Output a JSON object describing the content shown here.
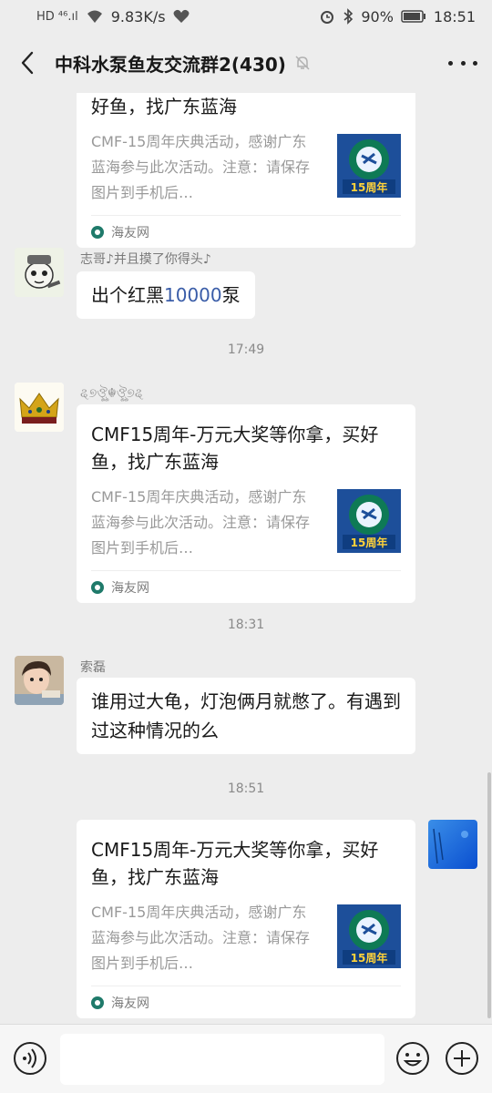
{
  "status_bar": {
    "left_icons": "HD ⁴⁶.ıl",
    "speed": "9.83K/s",
    "battery": "90%",
    "time": "18:51"
  },
  "header": {
    "title": "中科水泵鱼友交流群2(430)"
  },
  "messages": {
    "card_top": {
      "title": "好鱼，找广东蓝海",
      "desc": "CMF-15周年庆典活动，感谢广东蓝海参与此次活动。注意：请保存图片到手机后…",
      "source": "海友网",
      "thumb_label": "15周年"
    },
    "msg_zhige": {
      "sender": "志哥♪并且摸了你得头♪",
      "text_before": "出个红黑",
      "number": "10000",
      "text_after": "泵"
    },
    "time1": "17:49",
    "card_mid": {
      "sender": "ୡ୭ঔৣ☬ঔৣ୭ୡ",
      "title": "CMF15周年-万元大奖等你拿，买好鱼，找广东蓝海",
      "desc": "CMF-15周年庆典活动，感谢广东蓝海参与此次活动。注意：请保存图片到手机后…",
      "source": "海友网",
      "thumb_label": "15周年"
    },
    "time2": "18:31",
    "msg_suolei": {
      "sender": "索磊",
      "text": "谁用过大龟，灯泡俩月就憋了。有遇到过这种情况的么"
    },
    "time3": "18:51",
    "card_self": {
      "title": "CMF15周年-万元大奖等你拿，买好鱼，找广东蓝海",
      "desc": "CMF-15周年庆典活动，感谢广东蓝海参与此次活动。注意：请保存图片到手机后…",
      "source": "海友网",
      "thumb_label": "15周年"
    }
  },
  "colors": {
    "accent_number": "#3a5da8",
    "thumb_blue": "#1d4f9a",
    "thumb_green": "#0e7a55"
  }
}
